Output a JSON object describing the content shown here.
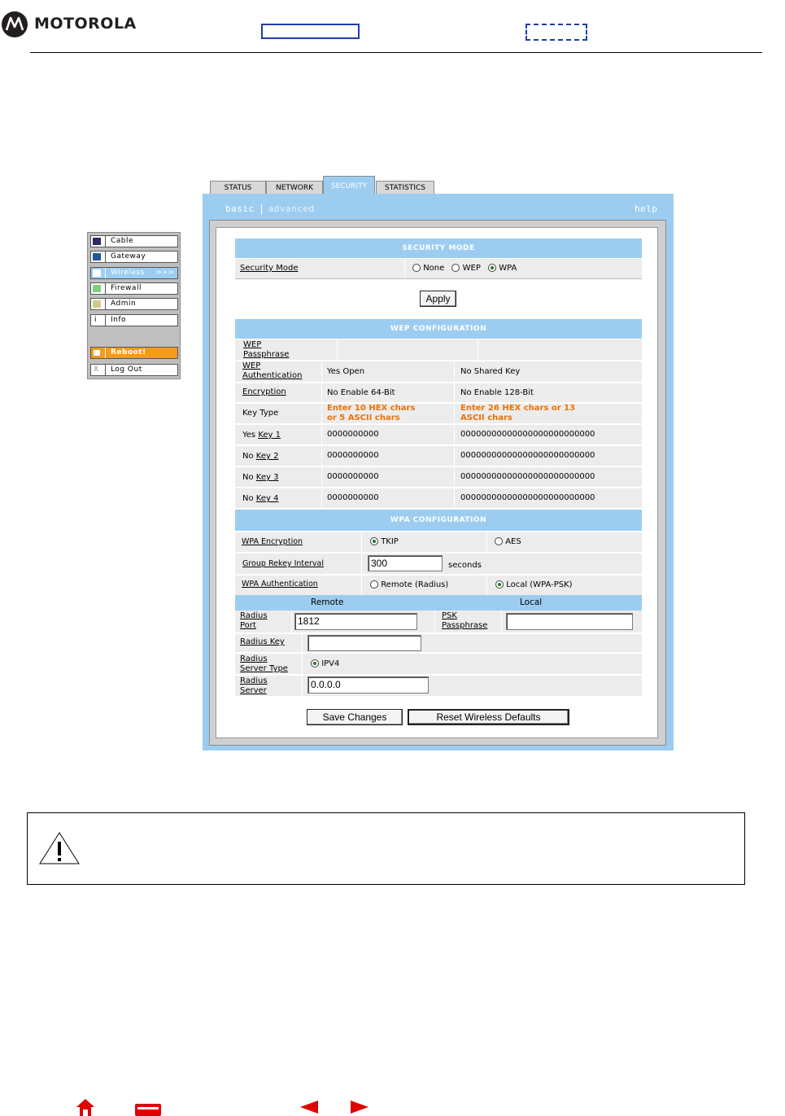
{
  "header": {
    "brand": "MOTOROLA"
  },
  "tabs": [
    {
      "label": "STATUS"
    },
    {
      "label": "NETWORK"
    },
    {
      "label": "SECURITY"
    },
    {
      "label": "STATISTICS"
    }
  ],
  "subnav": {
    "basic": "basic",
    "advanced": "advanced",
    "help": "help"
  },
  "sidebar": {
    "items": [
      {
        "label": "Cable",
        "color": "#2b2b5e"
      },
      {
        "label": "Gateway",
        "color": "#1e5a96"
      },
      {
        "label": "Wireless",
        "color": "#9ccdf0",
        "arrows": ">>>"
      },
      {
        "label": "Firewall",
        "color": "#7ccf7c"
      },
      {
        "label": "Admin",
        "color": "#cfc98a"
      },
      {
        "label": "Info",
        "glyph": "i"
      },
      {
        "label": "Reboot!",
        "color": "#f39a1e"
      },
      {
        "label": "Log Out",
        "glyph": "X"
      }
    ]
  },
  "security_mode": {
    "header": "SECURITY MODE",
    "label": "Security Mode",
    "options": [
      "None",
      "WEP",
      "WPA"
    ],
    "selected": "WPA",
    "apply": "Apply"
  },
  "wep": {
    "header": "WEP CONFIGURATION",
    "passphrase_label_1": "WEP",
    "passphrase_label_2": "Passphrase",
    "auth_label_1": "WEP",
    "auth_label_2": "Authentication",
    "auth_col1": "Yes Open",
    "auth_col2": "No Shared Key",
    "encryption_label": "Encryption",
    "enc_col1": "No Enable 64-Bit",
    "enc_col2": "No Enable 128-Bit",
    "keytype_label": "Key Type",
    "keytype_col1_a": "Enter 10 HEX chars",
    "keytype_col1_b": "or 5 ASCII chars",
    "keytype_col2_a": "Enter 26 HEX chars or 13",
    "keytype_col2_b": "ASCII chars",
    "keys": [
      {
        "prefix": "Yes",
        "label": "Key 1",
        "v1": "0000000000",
        "v2": "00000000000000000000000000"
      },
      {
        "prefix": "No",
        "label": "Key 2",
        "v1": "0000000000",
        "v2": "00000000000000000000000000"
      },
      {
        "prefix": "No",
        "label": "Key 3",
        "v1": "0000000000",
        "v2": "00000000000000000000000000"
      },
      {
        "prefix": "No",
        "label": "Key 4",
        "v1": "0000000000",
        "v2": "00000000000000000000000000"
      }
    ]
  },
  "wpa": {
    "header": "WPA CONFIGURATION",
    "enc_label": "WPA Encryption",
    "enc_opt1": "TKIP",
    "enc_opt2": "AES",
    "rekey_label": "Group Rekey Interval",
    "rekey_value": "300",
    "rekey_unit": "seconds",
    "auth_label": "WPA Authentication",
    "auth_opt1": "Remote (Radius)",
    "auth_opt2": "Local (WPA-PSK)",
    "remote_header": "Remote",
    "local_header": "Local",
    "radius_port_1": "Radius",
    "radius_port_2": "Port",
    "radius_port_value": "1812",
    "psk_1": "PSK",
    "psk_2": "Passphrase",
    "psk_value": "",
    "radius_key_label": "Radius Key",
    "radius_key_value": "",
    "server_type_1": "Radius",
    "server_type_2": "Server Type",
    "server_type_opt": "IPV4",
    "server_1": "Radius",
    "server_2": "Server",
    "server_value": "0.0.0.0"
  },
  "buttons": {
    "save": "Save Changes",
    "reset": "Reset Wireless Defaults"
  }
}
